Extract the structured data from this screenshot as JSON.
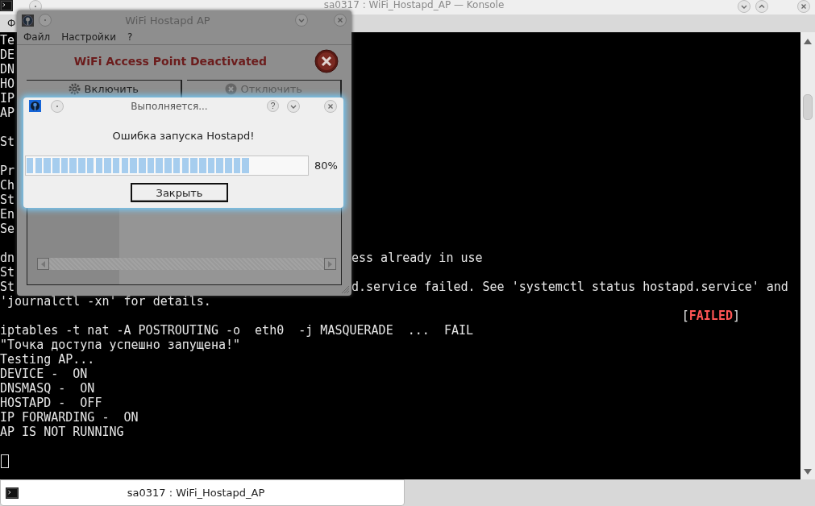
{
  "konsole": {
    "title": "sa0317 : WiFi_Hostapd_AP — Konsole",
    "menu": [
      "Ф"
    ],
    "lines": [
      {
        "kind": "text",
        "left": "Te"
      },
      {
        "kind": "text",
        "left": "DE"
      },
      {
        "kind": "text",
        "left": "DN"
      },
      {
        "kind": "text",
        "left": "HO"
      },
      {
        "kind": "text",
        "left": "IP"
      },
      {
        "kind": "text",
        "left": "AP"
      },
      {
        "kind": "blank"
      },
      {
        "kind": "text",
        "left": "St"
      },
      {
        "kind": "blank"
      },
      {
        "kind": "text",
        "left": "Pr"
      },
      {
        "kind": "text",
        "left": "Ch"
      },
      {
        "kind": "text",
        "left": "St"
      },
      {
        "kind": "text",
        "left": "En"
      },
      {
        "kind": "text",
        "left": "Se"
      },
      {
        "kind": "blank"
      },
      {
        "kind": "text",
        "left": "dn",
        "right": "ess already in use"
      },
      {
        "kind": "text",
        "left": "St"
      },
      {
        "kind": "text",
        "left": "St",
        "right": "d.service failed. See 'systemctl status hostapd.service' and"
      },
      {
        "kind": "text",
        "left": "'journalctl -xn' for details."
      },
      {
        "kind": "status",
        "open": "[",
        "label": "FAILED",
        "close": "]"
      },
      {
        "kind": "text",
        "left": "iptables -t nat -A POSTROUTING -o  eth0  -j MASQUERADE  ...  FAIL"
      },
      {
        "kind": "text",
        "left": "\"Точка доступа успешно запущена!\""
      },
      {
        "kind": "text",
        "left": "Testing AP..."
      },
      {
        "kind": "text",
        "left": "DEVICE -  ON"
      },
      {
        "kind": "text",
        "left": "DNSMASQ -  ON"
      },
      {
        "kind": "text",
        "left": "HOSTAPD -  OFF"
      },
      {
        "kind": "text",
        "left": "IP FORWARDING -  ON"
      },
      {
        "kind": "text",
        "left": "AP IS NOT RUNNING"
      },
      {
        "kind": "blank"
      },
      {
        "kind": "cursor"
      }
    ]
  },
  "app_window": {
    "title": "WiFi Hostapd AP",
    "menu": [
      "Файл",
      "Настройки",
      "?"
    ],
    "status": "WiFi Access Point Deactivated",
    "buttons": [
      {
        "label": "Включить",
        "disabled": false
      },
      {
        "label": "Отключить",
        "disabled": true
      }
    ]
  },
  "dialog": {
    "title": "Выполняется...",
    "help": "?",
    "message": "Ошибка запуска Hostapd!",
    "progress": {
      "level": 0.8,
      "reading": "80%"
    },
    "button": "Закрыть"
  },
  "taskbar": {
    "items": [
      {
        "label": "sa0317 : WiFi_Hostapd_AP",
        "selected": true
      }
    ]
  }
}
